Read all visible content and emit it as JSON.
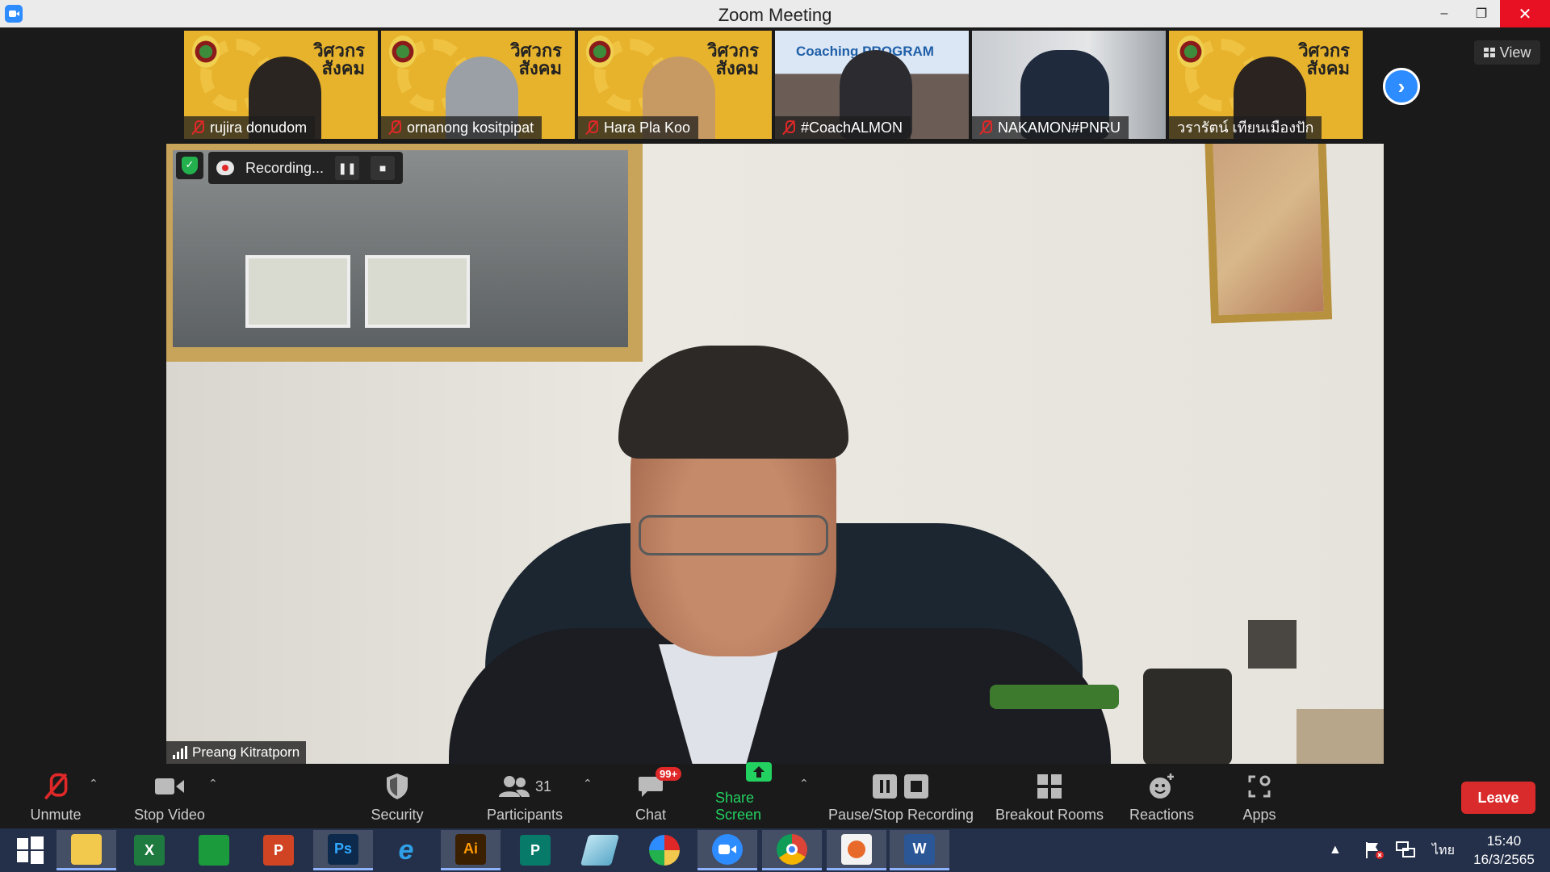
{
  "window": {
    "title": "Zoom Meeting",
    "minimize": "–",
    "maximize": "❐",
    "close": "✕"
  },
  "gallery": {
    "participants": [
      {
        "name": "rujira donudom",
        "bg": "yellow"
      },
      {
        "name": "ornanong kositpipat",
        "bg": "yellow"
      },
      {
        "name": "Hara Pla Koo",
        "bg": "yellow"
      },
      {
        "name": "#CoachALMON",
        "bg": "dark",
        "banner": "Coaching PROGRAM"
      },
      {
        "name": "NAKAMON#PNRU",
        "bg": "dark"
      },
      {
        "name": "วรารัตน์ เทียนเมืองปัก",
        "bg": "yellow"
      }
    ],
    "brand_line1": "วิศวกร",
    "brand_line2": "สังคม",
    "next_icon": "chevron-right-icon",
    "view_label": "View"
  },
  "recording": {
    "label": "Recording...",
    "pause_icon": "pause-icon",
    "stop_icon": "stop-icon"
  },
  "speaker": {
    "name": "Preang Kitratporn"
  },
  "toolbar": {
    "unmute": "Unmute",
    "stop_video": "Stop Video",
    "security": "Security",
    "participants": "Participants",
    "participants_count": "31",
    "chat": "Chat",
    "chat_badge": "99+",
    "share_screen": "Share Screen",
    "recording_controls": "Pause/Stop Recording",
    "breakout_rooms": "Breakout Rooms",
    "reactions": "Reactions",
    "apps": "Apps",
    "leave": "Leave"
  },
  "taskbar": {
    "apps": [
      {
        "name": "start-icon",
        "label": ""
      },
      {
        "name": "file-explorer-icon",
        "label": ""
      },
      {
        "name": "excel-icon",
        "label": "X"
      },
      {
        "name": "store-icon",
        "label": ""
      },
      {
        "name": "powerpoint-icon",
        "label": "P"
      },
      {
        "name": "photoshop-icon",
        "label": "Ps"
      },
      {
        "name": "internet-explorer-icon",
        "label": "e"
      },
      {
        "name": "illustrator-icon",
        "label": "Ai"
      },
      {
        "name": "publisher-icon",
        "label": "P"
      },
      {
        "name": "app-icon",
        "label": ""
      },
      {
        "name": "photoscape-icon",
        "label": ""
      },
      {
        "name": "zoom-icon",
        "label": ""
      },
      {
        "name": "chrome-icon",
        "label": ""
      },
      {
        "name": "office-icon",
        "label": ""
      },
      {
        "name": "word-icon",
        "label": "W"
      }
    ],
    "language": "ไทย",
    "time": "15:40",
    "date": "16/3/2565"
  },
  "colors": {
    "accent": "#2d8cff",
    "leave": "#d92b2b",
    "share": "#23d160",
    "record": "#e02828"
  }
}
